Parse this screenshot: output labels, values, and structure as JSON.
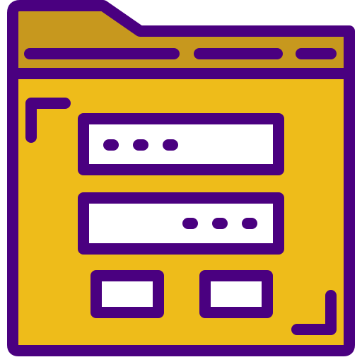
{
  "icon": {
    "name": "login-form-folder-icon",
    "colors": {
      "outline": "#4A0080",
      "folder_body": "#EEBC1A",
      "folder_header": "#C7981E",
      "field_fill": "#FFFFFF"
    },
    "parts": {
      "header_dashes": 3,
      "corner_marks": 2,
      "fields": [
        {
          "name": "username-field",
          "dots": 3,
          "dots_align": "left"
        },
        {
          "name": "password-field",
          "dots": 3,
          "dots_align": "right"
        }
      ],
      "buttons": [
        {
          "name": "left-button"
        },
        {
          "name": "right-button"
        }
      ]
    }
  }
}
